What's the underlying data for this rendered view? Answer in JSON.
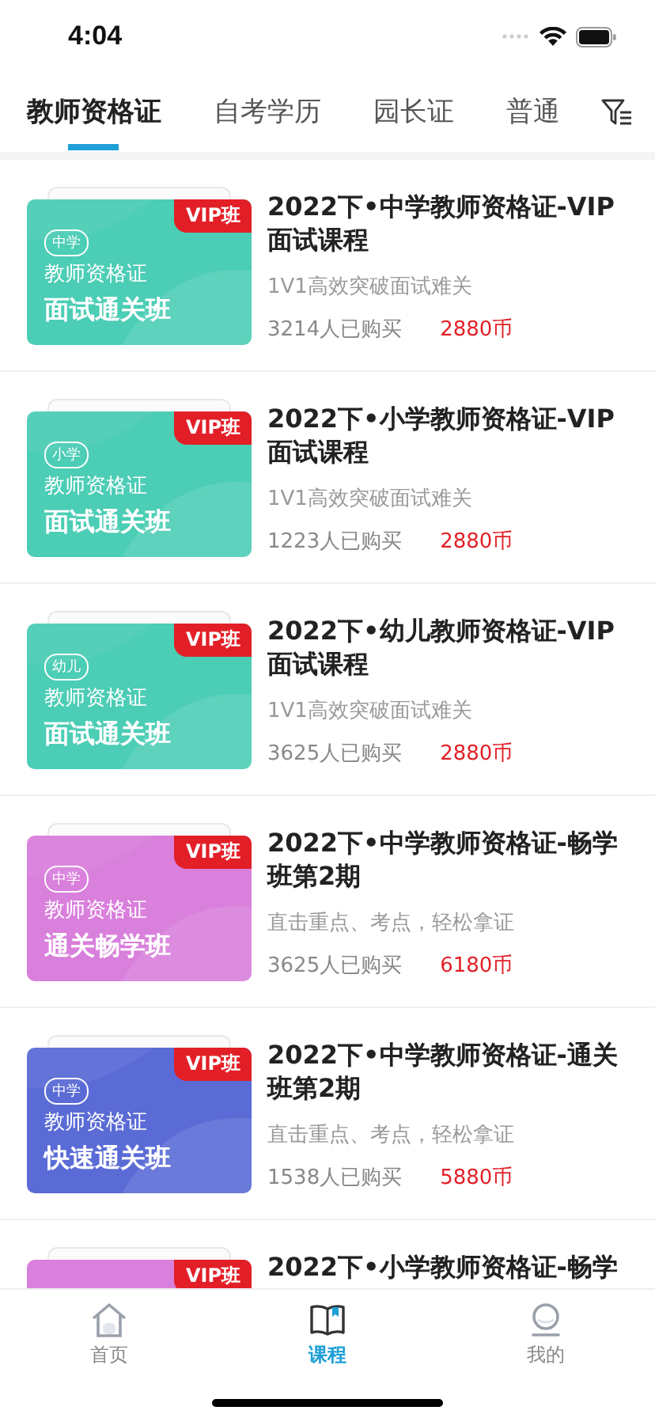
{
  "status_bar": {
    "time": "4:04"
  },
  "tabs": [
    {
      "label": "教师资格证",
      "selected": true
    },
    {
      "label": "自考学历",
      "selected": false
    },
    {
      "label": "园长证",
      "selected": false
    },
    {
      "label": "普通",
      "selected": false
    }
  ],
  "courses": [
    {
      "badge": "VIP班",
      "color": "#4ccdb5",
      "level_tag": "中学",
      "cover_line_1": "教师资格证",
      "cover_line_2": "面试通关班",
      "title": "2022下•中学教师资格证-VIP面试课程",
      "subtitle": "1V1高效突破面试难关",
      "buyers": "3214人已购买",
      "price": "2880币"
    },
    {
      "badge": "VIP班",
      "color": "#4ccdb5",
      "level_tag": "小学",
      "cover_line_1": "教师资格证",
      "cover_line_2": "面试通关班",
      "title": "2022下•小学教师资格证-VIP面试课程",
      "subtitle": "1V1高效突破面试难关",
      "buyers": "1223人已购买",
      "price": "2880币"
    },
    {
      "badge": "VIP班",
      "color": "#4ccdb5",
      "level_tag": "幼儿",
      "cover_line_1": "教师资格证",
      "cover_line_2": "面试通关班",
      "title": "2022下•幼儿教师资格证-VIP面试课程",
      "subtitle": "1V1高效突破面试难关",
      "buyers": "3625人已购买",
      "price": "2880币"
    },
    {
      "badge": "VIP班",
      "color": "#d97fdc",
      "level_tag": "中学",
      "cover_line_1": "教师资格证",
      "cover_line_2": "通关畅学班",
      "title": "2022下•中学教师资格证-畅学班第2期",
      "subtitle": "直击重点、考点，轻松拿证",
      "buyers": "3625人已购买",
      "price": "6180币"
    },
    {
      "badge": "VIP班",
      "color": "#5a6bd6",
      "level_tag": "中学",
      "cover_line_1": "教师资格证",
      "cover_line_2": "快速通关班",
      "title": "2022下•中学教师资格证-通关班第2期",
      "subtitle": "直击重点、考点，轻松拿证",
      "buyers": "1538人已购买",
      "price": "5880币"
    },
    {
      "badge": "VIP班",
      "color": "#d97fdc",
      "title": "2022下•小学教师资格证-畅学"
    }
  ],
  "bottom_nav": [
    {
      "kind": "home",
      "label": "首页",
      "selected": false
    },
    {
      "kind": "book",
      "label": "课程",
      "selected": true
    },
    {
      "kind": "profile",
      "label": "我的",
      "selected": false
    }
  ]
}
